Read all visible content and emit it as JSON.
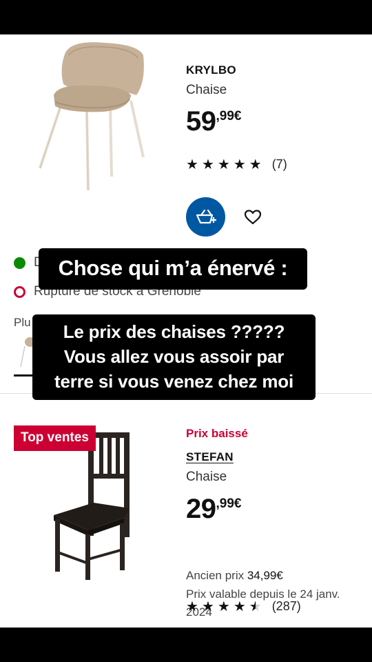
{
  "products": [
    {
      "name": "KRYLBO",
      "type": "Chaise",
      "price_main": "59",
      "price_sup": ",99€",
      "rating": 5,
      "reviews": "(7)",
      "stock": [
        {
          "status": "available",
          "text": "D"
        },
        {
          "status": "out",
          "text": "Rupture de stock à Grenoble"
        }
      ],
      "more_label": "Plu",
      "chair_color": "#c8b49a",
      "leg_color": "#e6dfd3"
    },
    {
      "badge": "Top ventes",
      "promo": "Prix baissé",
      "name": "STEFAN",
      "type": "Chaise",
      "price_main": "29",
      "price_sup": ",99€",
      "old_price_label": "Ancien prix",
      "old_price_value": "34,99€",
      "validity": "Prix valable depuis le 24 janv. 2024",
      "rating": 4.5,
      "reviews": "(287)",
      "chair_color": "#2b2420"
    }
  ],
  "captions": {
    "title": "Chose qui m’a énervé :",
    "body": [
      "Le prix des chaises ?????",
      "Vous allez vous assoir par",
      "terre si vous venez chez moi"
    ]
  },
  "icons": {
    "cart": "add-to-cart-icon",
    "heart": "heart-icon",
    "star": "star-icon"
  },
  "colors": {
    "ikea_blue": "#0058a3",
    "promo_red": "#cc0033",
    "stock_green": "#0a8a00"
  }
}
